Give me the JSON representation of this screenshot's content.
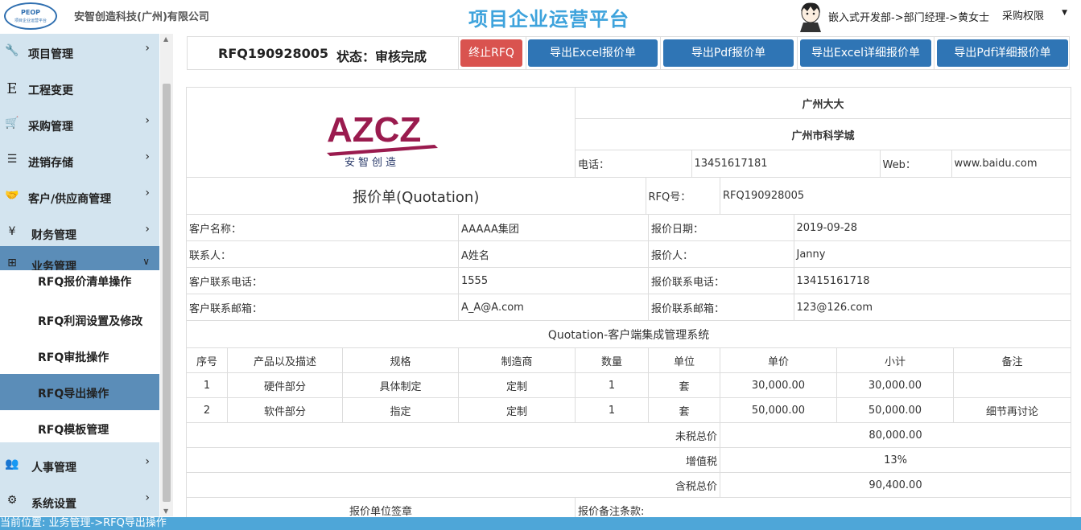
{
  "header": {
    "logo_line1": "PEOP",
    "logo_line2": "项目企业运营平台",
    "company": "安智创造科技(广州)有限公司",
    "app_title": "项目企业运营平台",
    "user_path": "嵌入式开发部->部门经理->黄女士",
    "role": "采购权限"
  },
  "sidebar": {
    "items": [
      {
        "label": "项目管理",
        "icon": "wrench-icon",
        "glyph": "🔧",
        "arrow": "›"
      },
      {
        "label": "工程变更",
        "icon": "letter-e-icon",
        "glyph": "E",
        "arrow": ""
      },
      {
        "label": "采购管理",
        "icon": "cart-icon",
        "glyph": "🛒",
        "arrow": "›"
      },
      {
        "label": "进销存储",
        "icon": "database-icon",
        "glyph": "☰",
        "arrow": "›"
      },
      {
        "label": "客户/供应商管理",
        "icon": "handshake-icon",
        "glyph": "🤝",
        "arrow": "›"
      },
      {
        "label": "财务管理",
        "icon": "yen-icon",
        "glyph": "¥",
        "arrow": "›"
      },
      {
        "label": "业务管理",
        "icon": "sitemap-icon",
        "glyph": "⊞",
        "arrow": "⌄"
      },
      {
        "label": "人事管理",
        "icon": "users-icon",
        "glyph": "👥",
        "arrow": "›"
      },
      {
        "label": "系统设置",
        "icon": "gear-icon",
        "glyph": "⚙",
        "arrow": "›"
      }
    ],
    "subitems": [
      {
        "label": "RFQ报价清单操作"
      },
      {
        "label": "RFQ利润设置及修改"
      },
      {
        "label": "RFQ审批操作"
      },
      {
        "label": "RFQ导出操作"
      },
      {
        "label": "RFQ模板管理"
      }
    ]
  },
  "toolbar": {
    "rfq_no": "RFQ190928005",
    "status": "状态：审核完成",
    "btn_stop": "终止RFQ",
    "btn_excel": "导出Excel报价单",
    "btn_pdf": "导出Pdf报价单",
    "btn_excel_detail": "导出Excel详细报价单",
    "btn_pdf_detail": "导出Pdf详细报价单"
  },
  "quote": {
    "brand_logo": "AZCZ",
    "brand_cn": "安智创造",
    "company_name": "广州大大",
    "address": "广州市科学城",
    "phone_label": "电话：",
    "phone": "13451617181",
    "web_label": "Web：",
    "web": "www.baidu.com",
    "doc_title": "报价单(Quotation)",
    "rfq_label": "RFQ号：",
    "rfq_no": "RFQ190928005",
    "customer_label": "客户名称：",
    "customer": "AAAAA集团",
    "date_label": "报价日期：",
    "date": "2019-09-28",
    "contact_label": "联系人：",
    "contact": "A姓名",
    "quoter_label": "报价人：",
    "quoter": "Janny",
    "cust_phone_label": "客户联系电话：",
    "cust_phone": "1555",
    "quoter_phone_label": "报价联系电话：",
    "quoter_phone": "13415161718",
    "cust_email_label": "客户联系邮箱：",
    "cust_email": "A_A@A.com",
    "quoter_email_label": "报价联系邮箱：",
    "quoter_email": "123@126.com",
    "project": "Quotation-客户端集成管理系统",
    "columns": [
      "序号",
      "产品以及描述",
      "规格",
      "制造商",
      "数量",
      "单位",
      "单价",
      "小计",
      "备注"
    ],
    "rows": [
      [
        "1",
        "硬件部分",
        "具体制定",
        "定制",
        "1",
        "套",
        "30,000.00",
        "30,000.00",
        ""
      ],
      [
        "2",
        "软件部分",
        "指定",
        "定制",
        "1",
        "套",
        "50,000.00",
        "50,000.00",
        "细节再讨论"
      ]
    ],
    "pretax_label": "未税总价",
    "pretax": "80,000.00",
    "vat_label": "增值税",
    "vat": "13%",
    "total_label": "含税总价",
    "total": "90,400.00",
    "stamp_label": "报价单位签章",
    "remark_label": "报价备注条款:"
  },
  "statusbar": {
    "text": "当前位置:  业务管理->RFQ导出操作"
  }
}
